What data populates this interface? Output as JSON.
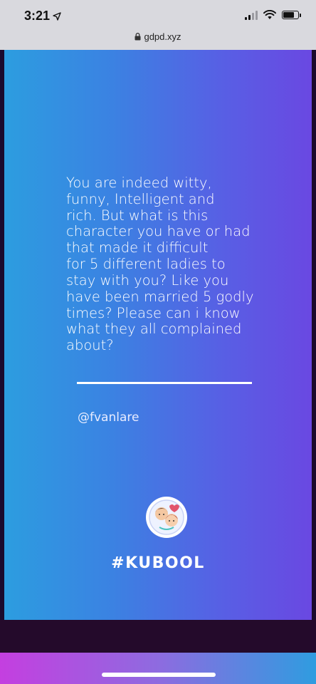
{
  "status_bar": {
    "time": "3:21",
    "signal_bars": 2,
    "battery_percent": 70
  },
  "browser": {
    "url": "gdpd.xyz"
  },
  "post": {
    "quote": "You are indeed witty,\nfunny, Intelligent and\nrich. But what is this\ncharacter you have or had\nthat made it difficult\nfor 5 different ladies to\nstay with you? Like you\nhave been married 5 godly\ntimes? Please can i know\nwhat they all complained\nabout?",
    "handle": "@fvanlare",
    "brand": "#KUBOOL"
  },
  "colors": {
    "gradient_start": "#2c9de0",
    "gradient_end": "#6a48e2",
    "bottom_bar_start": "#c43fe0",
    "bottom_bar_end": "#2f9ce0"
  },
  "icons": [
    "location-arrow-icon",
    "cellular-signal-icon",
    "wifi-icon",
    "battery-icon",
    "lock-icon",
    "kubool-logo-icon"
  ]
}
